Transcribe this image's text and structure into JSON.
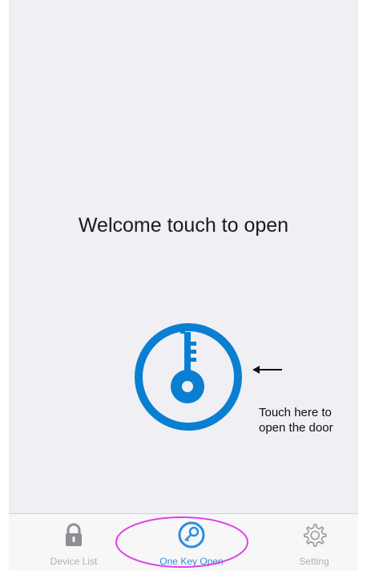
{
  "welcome": {
    "message": "Welcome touch to open"
  },
  "key_button": {
    "icon": "key-icon",
    "color": "#0a7fd1"
  },
  "annotation": {
    "arrow_icon": "left-arrow-icon",
    "hint_line1": "Touch here to",
    "hint_line2": "open the door",
    "highlight_color": "#e040e8"
  },
  "tab_bar": {
    "tabs": [
      {
        "label": "Device List",
        "icon": "lock-icon",
        "active": false
      },
      {
        "label": "One Key Open",
        "icon": "key-circle-icon",
        "active": true
      },
      {
        "label": "Setting",
        "icon": "gear-icon",
        "active": false
      }
    ],
    "active_color": "#2a8ee0",
    "inactive_color": "#b0b0b0"
  }
}
